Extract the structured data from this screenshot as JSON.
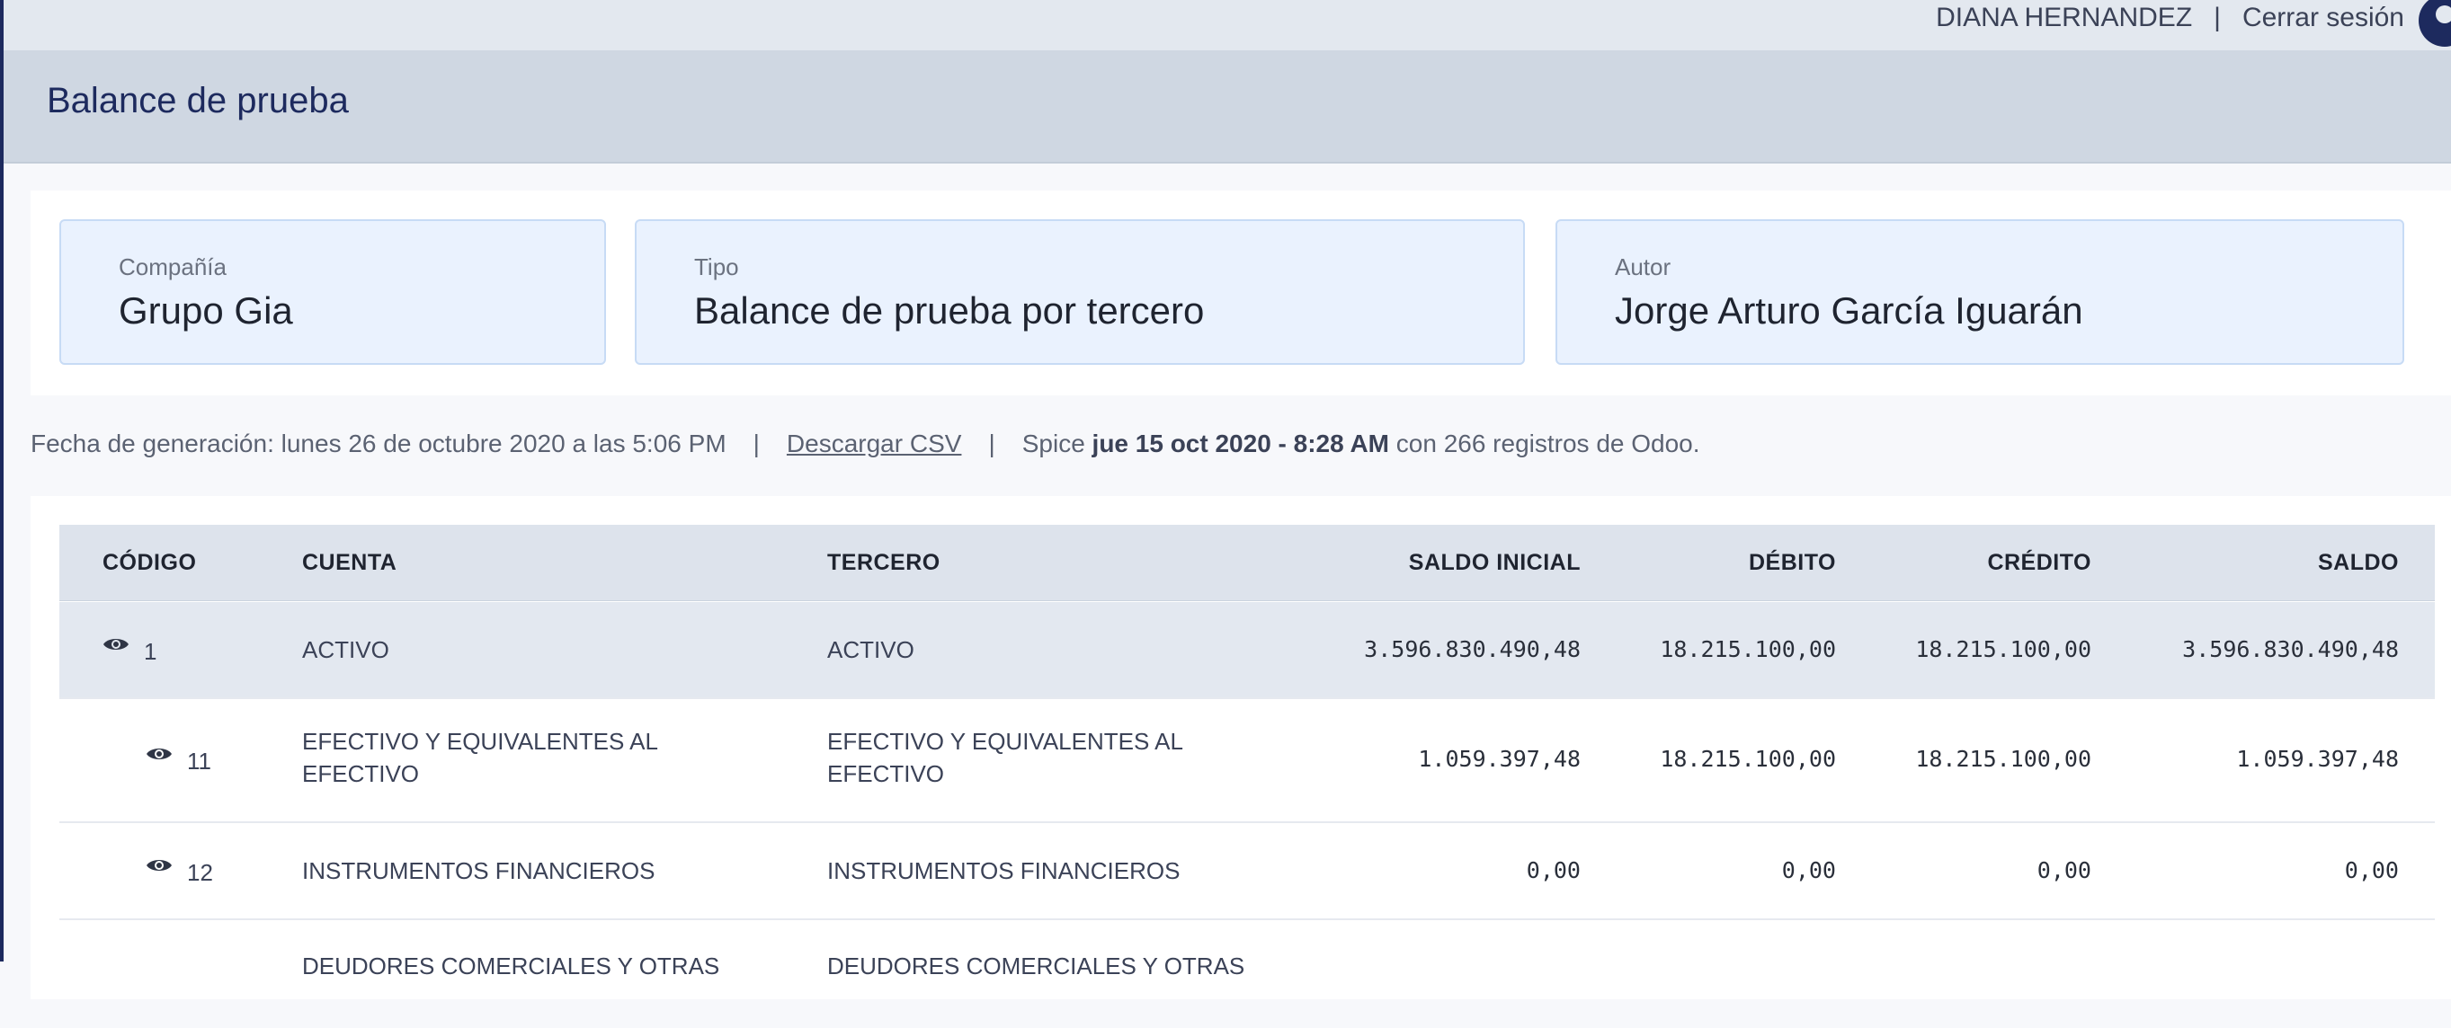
{
  "user": {
    "name": "DIANA HERNANDEZ",
    "separator": "|",
    "logout_label": "Cerrar sesión"
  },
  "page": {
    "title": "Balance de prueba"
  },
  "cards": {
    "company": {
      "label": "Compañía",
      "value": "Grupo Gia"
    },
    "type": {
      "label": "Tipo",
      "value": "Balance de prueba por tercero"
    },
    "author": {
      "label": "Autor",
      "value": "Jorge Arturo García Iguarán"
    }
  },
  "meta": {
    "generated": "Fecha de generación: lunes 26 de octubre 2020 a las 5:06 PM",
    "separator": "|",
    "download_label": "Descargar CSV",
    "spice_prefix": "Spice",
    "spice_date": "jue 15 oct 2020 - 8:28 AM",
    "spice_suffix": "con 266 registros de Odoo."
  },
  "table": {
    "headers": {
      "code": "CÓDIGO",
      "account": "CUENTA",
      "third": "TERCERO",
      "initial": "SALDO INICIAL",
      "debit": "DÉBITO",
      "credit": "CRÉDITO",
      "balance": "SALDO"
    },
    "rows": [
      {
        "code": "1",
        "account_l1": "ACTIVO",
        "account_l2": "",
        "third_l1": "ACTIVO",
        "third_l2": "",
        "initial": "3.596.830.490,48",
        "debit": "18.215.100,00",
        "credit": "18.215.100,00",
        "balance": "3.596.830.490,48"
      },
      {
        "code": "11",
        "account_l1": "EFECTIVO Y EQUIVALENTES AL",
        "account_l2": "EFECTIVO",
        "third_l1": "EFECTIVO Y EQUIVALENTES AL",
        "third_l2": "EFECTIVO",
        "initial": "1.059.397,48",
        "debit": "18.215.100,00",
        "credit": "18.215.100,00",
        "balance": "1.059.397,48"
      },
      {
        "code": "12",
        "account_l1": "INSTRUMENTOS FINANCIEROS",
        "account_l2": "",
        "third_l1": "INSTRUMENTOS FINANCIEROS",
        "third_l2": "",
        "initial": "0,00",
        "debit": "0,00",
        "credit": "0,00",
        "balance": "0,00"
      },
      {
        "code": "",
        "account_l1": "DEUDORES COMERCIALES Y OTRAS",
        "account_l2": "",
        "third_l1": "DEUDORES COMERCIALES Y OTRAS",
        "third_l2": "",
        "initial": "",
        "debit": "",
        "credit": "",
        "balance": ""
      }
    ]
  }
}
